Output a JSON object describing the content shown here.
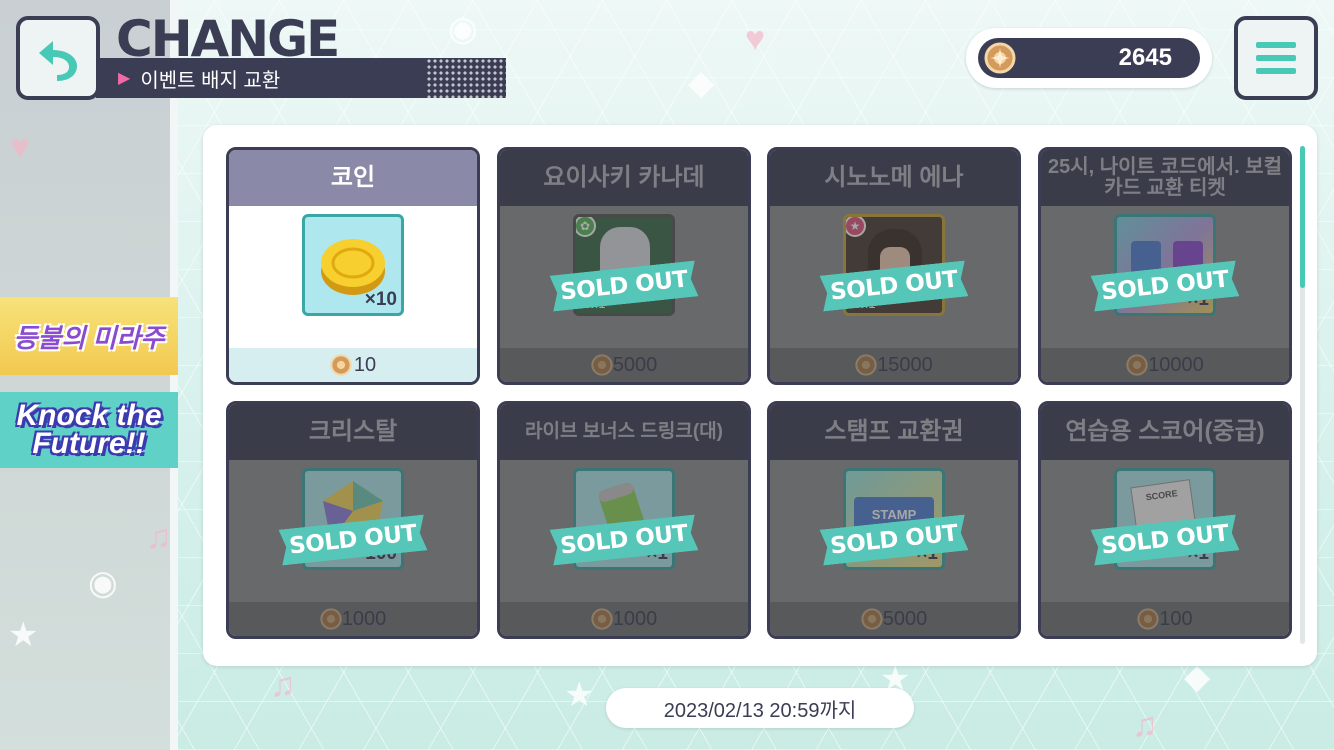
{
  "header": {
    "title": "CHANGE",
    "subtitle": "이벤트 배지 교환"
  },
  "currency": {
    "amount": "2645",
    "icon": "event-badge-icon"
  },
  "side_banners": [
    {
      "label": "등불의 미라주"
    },
    {
      "label": "Knock the Future!!"
    }
  ],
  "items": [
    {
      "name": "코인",
      "qty": "×10",
      "price": "10",
      "sold_out": false,
      "thumb": "gold-coin"
    },
    {
      "name": "요이사키 카나데",
      "qty": "",
      "level": "Lv.1",
      "price": "5000",
      "sold_out": true,
      "thumb": "character-card"
    },
    {
      "name": "시노노메 에나",
      "qty": "",
      "level": "Lv.1",
      "price": "15000",
      "sold_out": true,
      "thumb": "character-card"
    },
    {
      "name": "25시, 나이트 코드에서. 보컬 카드 교환 티켓",
      "qty": "×1",
      "price": "10000",
      "sold_out": true,
      "thumb": "ticket"
    },
    {
      "name": "크리스탈",
      "qty": "×100",
      "price": "1000",
      "sold_out": true,
      "thumb": "crystal"
    },
    {
      "name": "라이브 보너스 드링크(대)",
      "qty": "×1",
      "price": "1000",
      "sold_out": true,
      "thumb": "drink"
    },
    {
      "name": "스탬프 교환권",
      "qty": "×1",
      "price": "5000",
      "sold_out": true,
      "thumb": "stamp-ticket",
      "thumb_text": "STAMP"
    },
    {
      "name": "연습용 스코어(중급)",
      "qty": "×1",
      "price": "100",
      "sold_out": true,
      "thumb": "score",
      "thumb_text": "SCORE"
    }
  ],
  "sold_out_label": "SOLD OUT",
  "deadline": "2023/02/13 20:59까지",
  "colors": {
    "accent": "#48c9b6",
    "navy": "#3b3d55",
    "pink": "#f06aa6"
  }
}
